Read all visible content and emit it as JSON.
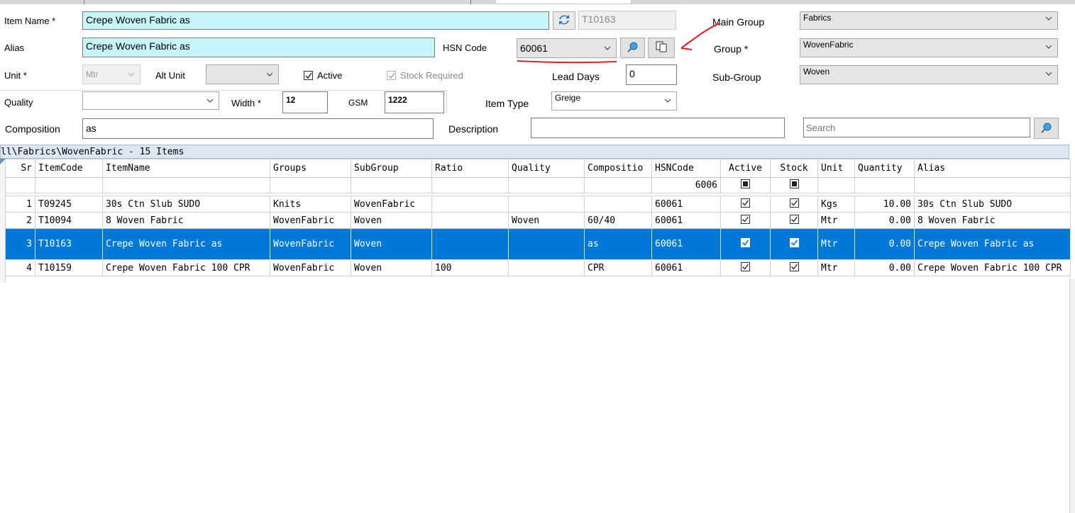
{
  "form": {
    "item_name_label": "Item Name *",
    "item_name_value": "Crepe Woven Fabric  as",
    "item_code_value": "T10163",
    "alias_label": "Alias",
    "alias_value": "Crepe Woven Fabric  as",
    "hsn_label": "HSN Code",
    "hsn_value": "60061",
    "unit_label": "Unit *",
    "unit_value": "Mtr",
    "alt_unit_label": "Alt Unit",
    "alt_unit_value": "",
    "active_label": "Active",
    "active_checked": true,
    "stock_required_label": "Stock Required",
    "stock_required_checked": true,
    "lead_days_label": "Lead Days",
    "lead_days_value": "0",
    "quality_label": "Quality",
    "quality_value": "",
    "width_label": "Width *",
    "width_value": "12",
    "gsm_label": "GSM",
    "gsm_value": "1222",
    "item_type_label": "Item Type",
    "item_type_value": "Greige",
    "composition_label": "Composition",
    "composition_value": "as",
    "description_label": "Description",
    "description_value": "",
    "main_group_label": "Main Group",
    "main_group_value": "Fabrics",
    "group_label": "Group *",
    "group_value": "WovenFabric",
    "sub_group_label": "Sub-Group",
    "sub_group_value": "Woven",
    "search_placeholder": "Search"
  },
  "icons": {
    "refresh": "refresh-icon",
    "lookup": "magnifier-icon",
    "copy": "copy-icon",
    "chevron": "chevron-down-icon"
  },
  "grid": {
    "title": "ll\\Fabrics\\WovenFabric - 15 Items",
    "columns": [
      "Sr",
      "ItemCode",
      "ItemName",
      "Groups",
      "SubGroup",
      "Ratio",
      "Quality",
      "Compositio",
      "HSNCode",
      "Active",
      "Stock",
      "Unit",
      "Quantity",
      "Alias"
    ],
    "filter_hsn": "6006",
    "rows": [
      {
        "sr": "1",
        "code": "T09245",
        "name": "30s Ctn Slub SUDO",
        "groups": "Knits",
        "subgroup": "WovenFabric",
        "ratio": "",
        "quality": "",
        "composition": "",
        "hsn": "60061",
        "active": true,
        "stock": true,
        "unit": "Kgs",
        "quantity": "10.00",
        "alias": "30s Ctn Slub SUDO"
      },
      {
        "sr": "2",
        "code": "T10094",
        "name": "8  Woven Fabric",
        "groups": "WovenFabric",
        "subgroup": "Woven",
        "ratio": "",
        "quality": "Woven",
        "composition": "60/40",
        "hsn": "60061",
        "active": true,
        "stock": true,
        "unit": "Mtr",
        "quantity": "0.00",
        "alias": "8  Woven Fabric"
      },
      {
        "sr": "3",
        "code": "T10163",
        "name": "Crepe Woven Fabric  as",
        "groups": "WovenFabric",
        "subgroup": "Woven",
        "ratio": "",
        "quality": "",
        "composition": "as",
        "hsn": "60061",
        "active": true,
        "stock": true,
        "unit": "Mtr",
        "quantity": "0.00",
        "alias": "Crepe Woven Fabric  as"
      },
      {
        "sr": "4",
        "code": "T10159",
        "name": "Crepe Woven Fabric 100 CPR",
        "groups": "WovenFabric",
        "subgroup": "Woven",
        "ratio": "100",
        "quality": "",
        "composition": "CPR",
        "hsn": "60061",
        "active": true,
        "stock": true,
        "unit": "Mtr",
        "quantity": "0.00",
        "alias": "Crepe Woven Fabric 100 CPR"
      }
    ],
    "selected_row": 3
  },
  "colors": {
    "cyan_field": "#c6f6fa",
    "selection": "#0078d7",
    "annotation": "#e8201e"
  }
}
